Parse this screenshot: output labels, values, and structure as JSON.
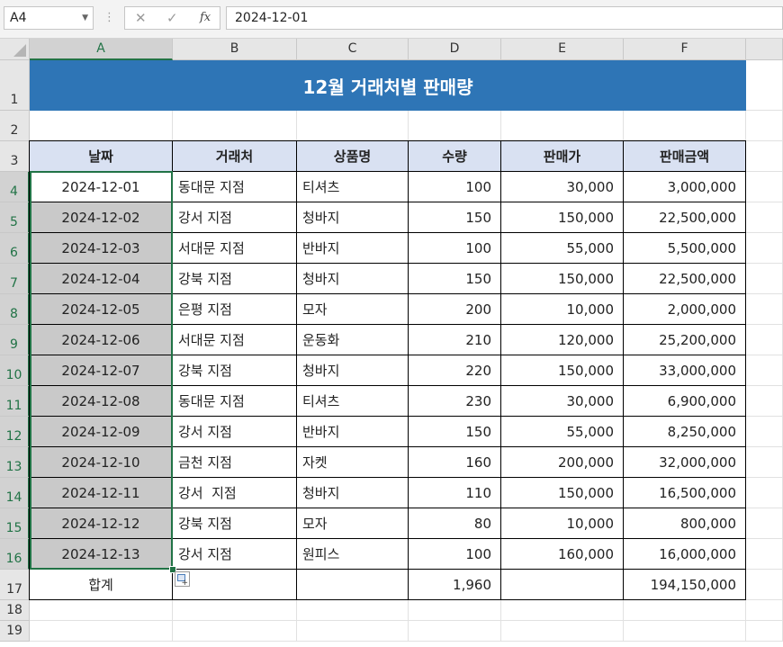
{
  "formula_bar": {
    "name_box": "A4",
    "cancel_icon": "✕",
    "enter_icon": "✓",
    "fx_label": "fx",
    "content": "2024-12-01"
  },
  "columns": [
    "A",
    "B",
    "C",
    "D",
    "E",
    "F"
  ],
  "rows": [
    "1",
    "2",
    "3",
    "4",
    "5",
    "6",
    "7",
    "8",
    "9",
    "10",
    "11",
    "12",
    "13",
    "14",
    "15",
    "16",
    "17",
    "18",
    "19"
  ],
  "sheet": {
    "title": "12월 거래처별 판매량",
    "headers": [
      "날짜",
      "거래처",
      "상품명",
      "수량",
      "판매가",
      "판매금액"
    ],
    "records": [
      [
        "2024-12-01",
        "동대문 지점",
        "티셔츠",
        "100",
        "30,000",
        "3,000,000"
      ],
      [
        "2024-12-02",
        "강서 지점",
        "청바지",
        "150",
        "150,000",
        "22,500,000"
      ],
      [
        "2024-12-03",
        "서대문 지점",
        "반바지",
        "100",
        "55,000",
        "5,500,000"
      ],
      [
        "2024-12-04",
        "강북 지점",
        "청바지",
        "150",
        "150,000",
        "22,500,000"
      ],
      [
        "2024-12-05",
        "은평 지점",
        "모자",
        "200",
        "10,000",
        "2,000,000"
      ],
      [
        "2024-12-06",
        "서대문 지점",
        "운동화",
        "210",
        "120,000",
        "25,200,000"
      ],
      [
        "2024-12-07",
        "강북 지점",
        "청바지",
        "220",
        "150,000",
        "33,000,000"
      ],
      [
        "2024-12-08",
        "동대문 지점",
        "티셔츠",
        "230",
        "30,000",
        "6,900,000"
      ],
      [
        "2024-12-09",
        "강서 지점",
        "반바지",
        "150",
        "55,000",
        "8,250,000"
      ],
      [
        "2024-12-10",
        "금천 지점",
        "자켓",
        "160",
        "200,000",
        "32,000,000"
      ],
      [
        "2024-12-11",
        "강서  지점",
        "청바지",
        "110",
        "150,000",
        "16,500,000"
      ],
      [
        "2024-12-12",
        "강북 지점",
        "모자",
        "80",
        "10,000",
        "800,000"
      ],
      [
        "2024-12-13",
        "강서 지점",
        "원피스",
        "100",
        "160,000",
        "16,000,000"
      ]
    ],
    "total": {
      "label": "합계",
      "qty": "1,960",
      "amount": "194,150,000"
    }
  },
  "colors": {
    "title_bg": "#2e75b6",
    "header_bg": "#d9e1f2",
    "selected_bg": "#c9c9c9",
    "selection_border": "#217346"
  }
}
